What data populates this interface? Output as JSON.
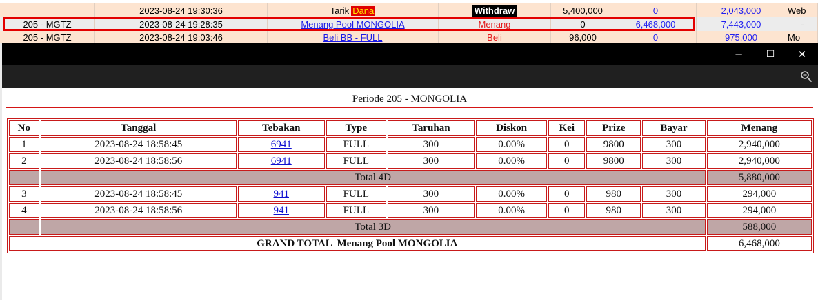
{
  "background_rows": [
    {
      "id": "",
      "datetime": "2023-08-24 19:30:36",
      "desc": "Tarik",
      "desc_badge": "Dana",
      "type": "Withdraw",
      "amount": "5,400,000",
      "win": "0",
      "balance": "2,043,000",
      "extra": "Web"
    },
    {
      "id": "205 - MGTZ",
      "datetime": "2023-08-24 19:28:35",
      "desc": "Menang Pool MONGOLIA",
      "type": "Menang",
      "amount": "0",
      "win": "6,468,000",
      "balance": "7,443,000",
      "extra": "-"
    },
    {
      "id": "205 - MGTZ",
      "datetime": "2023-08-24 19:03:46",
      "desc": "Beli BB - FULL",
      "type": "Beli",
      "amount": "96,000",
      "win": "0",
      "balance": "975,000",
      "extra": "Mo"
    }
  ],
  "window": {
    "minimize_icon": "─",
    "maximize_icon": "☐",
    "close_icon": "✕"
  },
  "period_title": "Periode 205 - MONGOLIA",
  "table": {
    "headers": [
      "No",
      "Tanggal",
      "Tebakan",
      "Type",
      "Taruhan",
      "Diskon",
      "Kei",
      "Prize",
      "Bayar",
      "Menang"
    ],
    "rows": [
      {
        "no": "1",
        "tanggal": "2023-08-24 18:58:45",
        "tebakan": "6941",
        "type": "FULL",
        "taruhan": "300",
        "diskon": "0.00%",
        "kei": "0",
        "prize": "9800",
        "bayar": "300",
        "menang": "2,940,000"
      },
      {
        "no": "2",
        "tanggal": "2023-08-24 18:58:56",
        "tebakan": "6941",
        "type": "FULL",
        "taruhan": "300",
        "diskon": "0.00%",
        "kei": "0",
        "prize": "9800",
        "bayar": "300",
        "menang": "2,940,000"
      },
      {
        "no": "3",
        "tanggal": "2023-08-24 18:58:45",
        "tebakan": "941",
        "type": "FULL",
        "taruhan": "300",
        "diskon": "0.00%",
        "kei": "0",
        "prize": "980",
        "bayar": "300",
        "menang": "294,000"
      },
      {
        "no": "4",
        "tanggal": "2023-08-24 18:58:56",
        "tebakan": "941",
        "type": "FULL",
        "taruhan": "300",
        "diskon": "0.00%",
        "kei": "0",
        "prize": "980",
        "bayar": "300",
        "menang": "294,000"
      }
    ],
    "total_4d_label": "Total 4D",
    "total_4d_value": "5,880,000",
    "total_3d_label": "Total 3D",
    "total_3d_value": "588,000",
    "grand_total_label": "GRAND TOTAL  Menang Pool MONGOLIA",
    "grand_total_value": "6,468,000"
  },
  "colors": {
    "accent_red": "#d41515",
    "total_row_bg": "#bfa6a6",
    "titlebar_bg": "#000000",
    "toolbar_bg": "#202020"
  }
}
